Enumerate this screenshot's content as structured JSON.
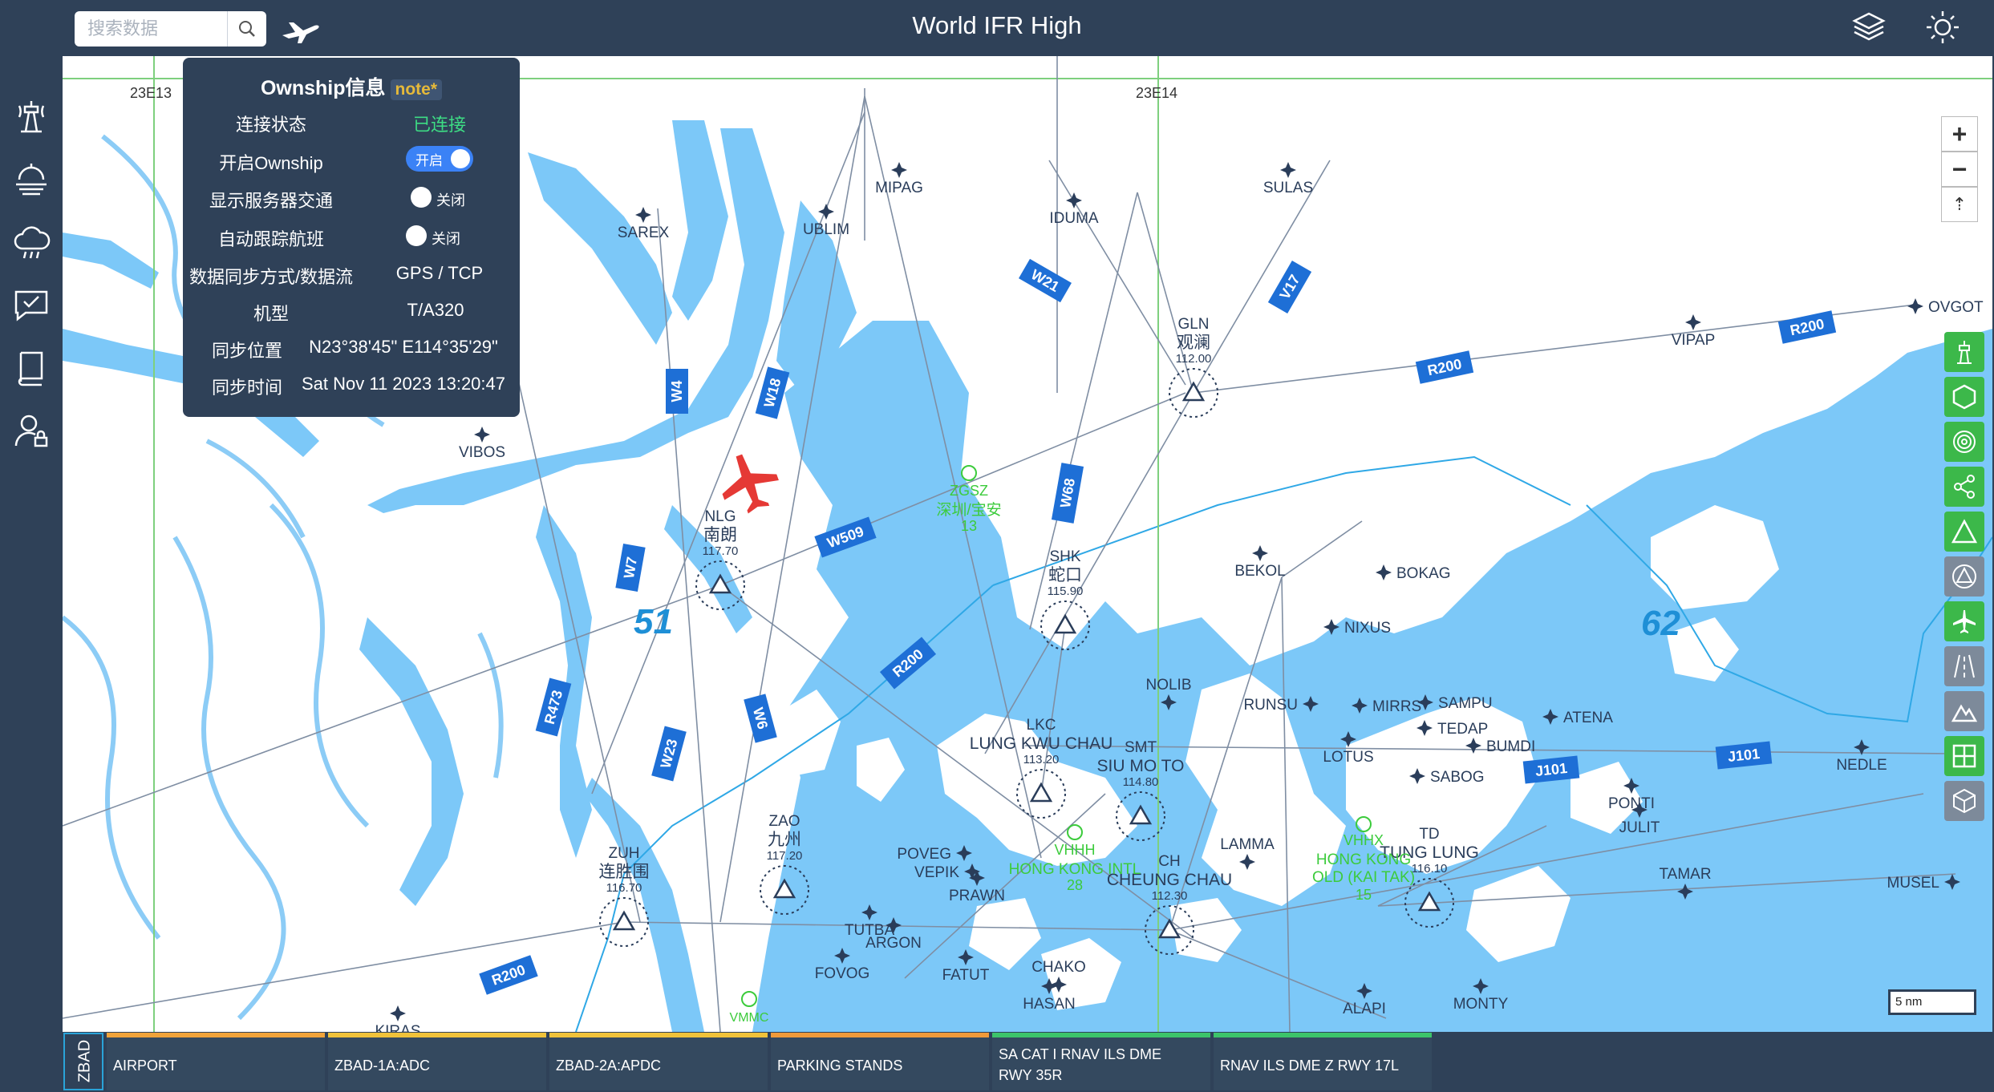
{
  "app": {
    "title": "World IFR High"
  },
  "search": {
    "placeholder": "搜索数据"
  },
  "topbar": {
    "icons": [
      "search-icon",
      "plane-icon",
      "layers-icon",
      "sun-icon"
    ]
  },
  "sidebar": {
    "icons": [
      "tower-icon",
      "weather-icon",
      "cloud-rain-icon",
      "chat-icon",
      "book-icon",
      "user-icon"
    ]
  },
  "ownship": {
    "title": "Ownship信息",
    "note": "note*",
    "rows": [
      {
        "label": "连接状态",
        "value": "已连接",
        "color": "#3ddc84"
      },
      {
        "label": "开启Ownship",
        "toggle": "开启"
      },
      {
        "label": "显示服务器交通",
        "toggle": "关闭"
      },
      {
        "label": "自动跟踪航班",
        "toggle": "关闭"
      },
      {
        "label": "数据同步方式/数据流",
        "value": "GPS / TCP"
      },
      {
        "label": "机型",
        "value": "T/A320"
      },
      {
        "label": "同步位置",
        "value": "N23°38'45\" E114°35'29\""
      },
      {
        "label": "同步时间",
        "value": "Sat Nov 11 2023 13:20:47"
      }
    ]
  },
  "map": {
    "grid_labels": [
      "23E13",
      "23E14"
    ],
    "sector_labels": [
      "51",
      "62"
    ],
    "airways": [
      "W4",
      "W18",
      "W21",
      "V17",
      "R200",
      "R200",
      "W68",
      "W509",
      "W7",
      "R200",
      "R473",
      "W23",
      "W6",
      "J101",
      "J101",
      "R200"
    ],
    "fixes": [
      "MIPAG",
      "SULAS",
      "UBLIM",
      "IDUMA",
      "SAREX",
      "VIPAP",
      "OVGOT",
      "VIBOS",
      "BOKAG",
      "BEKOL",
      "NIXUS",
      "NOLIB",
      "RUNSU",
      "MIRRS",
      "SAMPU",
      "ATENA",
      "TEDAP",
      "LOTUS",
      "BUMDI",
      "SABOG",
      "PONTI",
      "NEDLE",
      "JULIT",
      "POVEG",
      "VEPIK",
      "PRAWN",
      "TUTBA",
      "ARGON",
      "FOVOG",
      "FATUT",
      "CHAKO",
      "HASAN",
      "LAMMA",
      "TAMAR",
      "MUSEL",
      "ALAPI",
      "MONTY",
      "KIRAS"
    ],
    "navaids": [
      {
        "id": "GLN",
        "name": "观澜",
        "freq": "112.00"
      },
      {
        "id": "NLG",
        "name": "南朗",
        "freq": "117.70"
      },
      {
        "id": "SHK",
        "name": "蛇口",
        "freq": "115.90"
      },
      {
        "id": "LKC",
        "name": "LUNG KWU CHAU",
        "freq": "113.20"
      },
      {
        "id": "SMT",
        "name": "SIU MO TO",
        "freq": "114.80"
      },
      {
        "id": "ZAO",
        "name": "九州",
        "freq": "117.20"
      },
      {
        "id": "ZUH",
        "name": "连胜围",
        "freq": "116.70"
      },
      {
        "id": "CH",
        "name": "CHEUNG CHAU",
        "freq": "112.30"
      },
      {
        "id": "TD",
        "name": "TUNG LUNG",
        "freq": "116.10"
      }
    ],
    "airports": [
      {
        "id": "ZGSZ",
        "name": "深圳/宝安",
        "num": "13"
      },
      {
        "id": "VHHH",
        "name": "HONG KONG INTL",
        "num": "28"
      },
      {
        "id": "VHHX",
        "name": "HONG KONG",
        "name2": "OLD (KAI TAK)",
        "num": "15"
      },
      {
        "id": "VMMC",
        "name": "",
        "num": ""
      }
    ],
    "scale": "5 nm"
  },
  "right_toolbar": {
    "icons": [
      "tower-icon",
      "hexagon-icon",
      "target-icon",
      "share-icon",
      "triangle-icon",
      "circle-triangle-icon",
      "airplane-icon",
      "runway-icon",
      "terrain-icon",
      "grid-icon",
      "cube-icon"
    ]
  },
  "zoom": {
    "in": "+",
    "out": "−",
    "reset": "⇡"
  },
  "bottom": {
    "airport_code": "ZBAD",
    "tabs": [
      {
        "label": "AIRPORT",
        "color": "#f0a33a"
      },
      {
        "label": "ZBAD-1A:ADC",
        "color": "#f0c23a"
      },
      {
        "label": "ZBAD-2A:APDC",
        "color": "#f0c23a"
      },
      {
        "label": "PARKING STANDS",
        "color": "#f09a3a"
      },
      {
        "label": "SA CAT I RNAV ILS DME",
        "label2": "RWY 35R",
        "color": "#3cc46a"
      },
      {
        "label": "RNAV ILS DME Z RWY 17L",
        "color": "#3cc46a"
      }
    ]
  }
}
